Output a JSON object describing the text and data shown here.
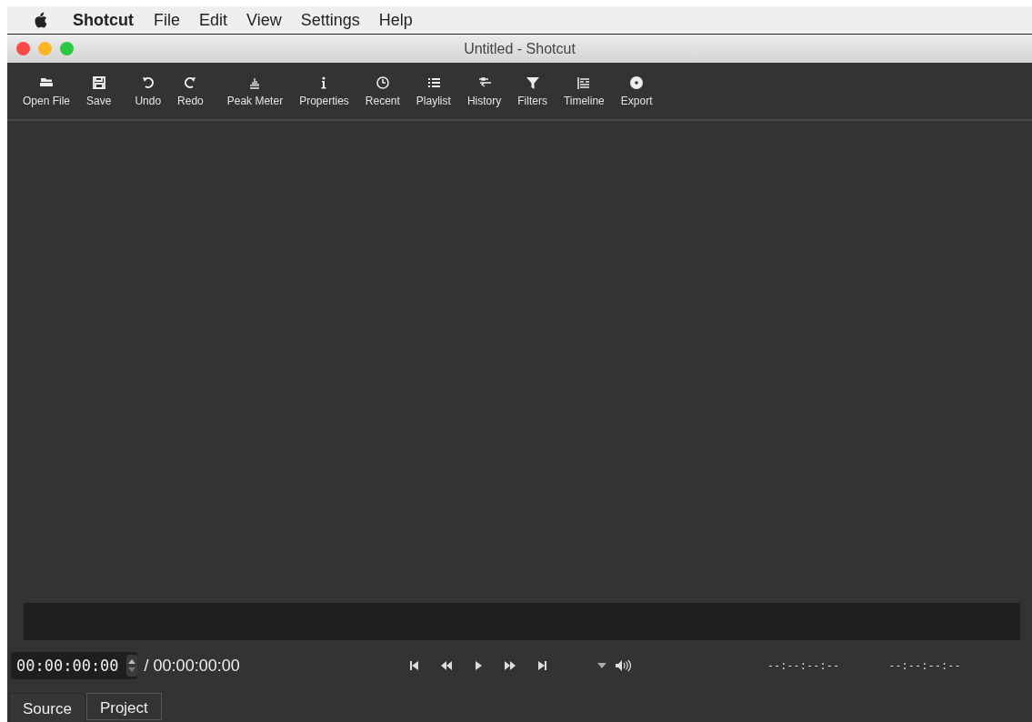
{
  "menu_bar": {
    "app_name": "Shotcut",
    "items": [
      "File",
      "Edit",
      "View",
      "Settings",
      "Help"
    ]
  },
  "window": {
    "title": "Untitled - Shotcut"
  },
  "toolbar": [
    {
      "label": "Open File"
    },
    {
      "label": "Save"
    },
    {
      "label": "Undo"
    },
    {
      "label": "Redo"
    },
    {
      "label": "Peak Meter"
    },
    {
      "label": "Properties"
    },
    {
      "label": "Recent"
    },
    {
      "label": "Playlist"
    },
    {
      "label": "History"
    },
    {
      "label": "Filters"
    },
    {
      "label": "Timeline"
    },
    {
      "label": "Export"
    }
  ],
  "transport": {
    "position": "00:00:00:00",
    "duration": "/ 00:00:00:00",
    "in_point": "--:--:--:--",
    "out_point": "--:--:--:--"
  },
  "tabs": [
    {
      "label": "Source",
      "selected": true
    },
    {
      "label": "Project",
      "selected": false
    }
  ]
}
